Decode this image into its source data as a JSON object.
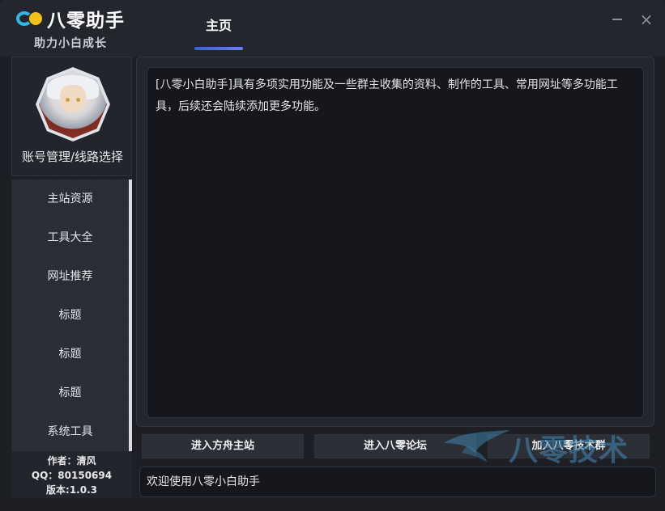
{
  "app": {
    "logo_text": "八零助手",
    "tagline": "助力小白成长",
    "colors": {
      "accent": "#4a67e0",
      "logo_ring": "#2fb7e6",
      "logo_dot": "#f2c21a"
    }
  },
  "header": {
    "tabs": [
      {
        "label": "主页",
        "active": true
      }
    ],
    "window_controls": {
      "minimize": "minimize-icon",
      "close": "×"
    }
  },
  "sidebar": {
    "account_label": "账号管理/线路选择",
    "items": [
      {
        "label": "主站资源"
      },
      {
        "label": "工具大全"
      },
      {
        "label": "网址推荐"
      },
      {
        "label": "标题"
      },
      {
        "label": "标题"
      },
      {
        "label": "标题"
      },
      {
        "label": "系统工具"
      }
    ],
    "about": {
      "author": "作者：清风",
      "qq": "QQ：80150694",
      "version": "版本:1.0.3"
    }
  },
  "main": {
    "description": "[八零小白助手]具有多项实用功能及一些群主收集的资料、制作的工具、常用网址等多功能工具，后续还会陆续添加更多功能。"
  },
  "actions": {
    "enter_site": "进入方舟主站",
    "enter_forum": "进入八零论坛",
    "join_group": "加入八零技术群"
  },
  "status": {
    "message": "欢迎使用八零小白助手"
  },
  "watermark": {
    "text": "八零技术",
    "icon": "bird-logo-icon"
  }
}
